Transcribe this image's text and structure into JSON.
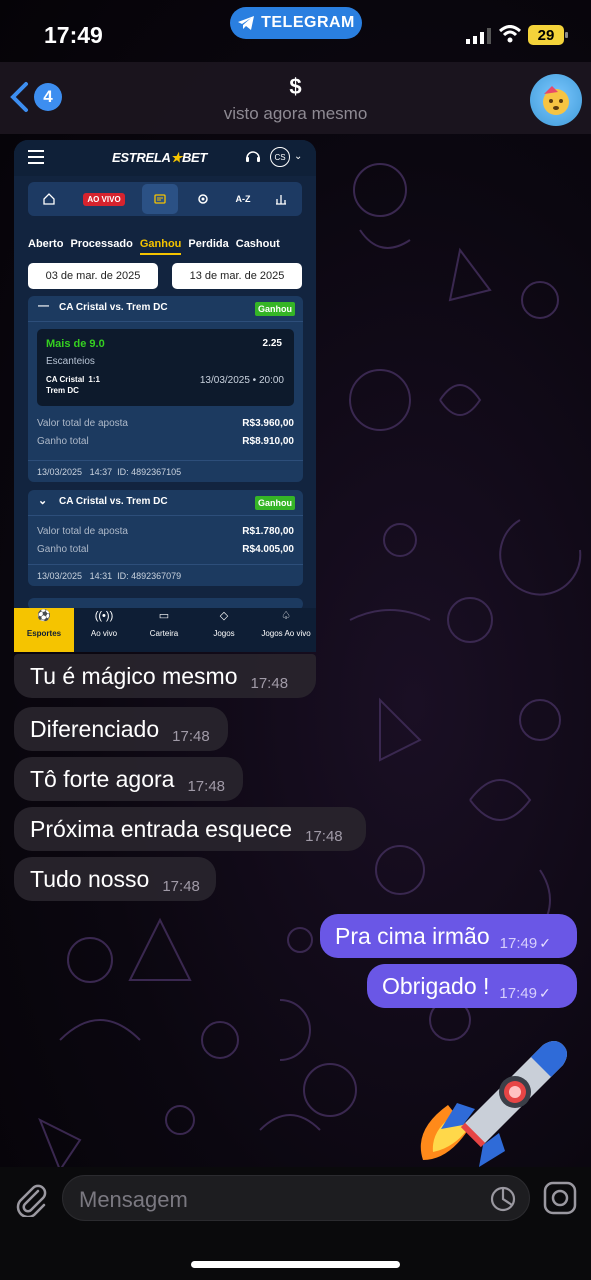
{
  "status_bar": {
    "time": "17:49",
    "app_pill": "TELEGRAM",
    "battery": "29"
  },
  "header": {
    "back_count": "4",
    "title": "$",
    "subtitle": "visto agora mesmo"
  },
  "screenshot": {
    "brand_left": "ESTRELA",
    "brand_right": "BET",
    "account": "CS",
    "nav": {
      "live": "AO VIVO",
      "az": "A-Z"
    },
    "tabs": [
      "Aberto",
      "Processado",
      "Ganhou",
      "Perdida",
      "Cashout"
    ],
    "active_tab": "Ganhou",
    "date_from": "03 de mar. de 2025",
    "date_to": "13 de mar. de 2025",
    "bets": [
      {
        "match": "CA Cristal vs. Trem DC",
        "status": "Ganhou",
        "pick": "Mais de 9.0",
        "odd": "2.25",
        "market": "Escanteios",
        "home": "CA Cristal",
        "score": "1:1",
        "away": "Trem DC",
        "kickoff": "13/03/2025 • 20:00",
        "stake_label": "Valor total de aposta",
        "stake": "R$3.960,00",
        "win_label": "Ganho total",
        "win": "R$8.910,00",
        "footer_date": "13/03/2025",
        "footer_time": "14:37",
        "footer_id": "ID: 4892367105"
      },
      {
        "match": "CA Cristal vs. Trem DC",
        "status": "Ganhou",
        "stake_label": "Valor total de aposta",
        "stake": "R$1.780,00",
        "win_label": "Ganho total",
        "win": "R$4.005,00",
        "footer_date": "13/03/2025",
        "footer_time": "14:31",
        "footer_id": "ID: 4892367079"
      }
    ],
    "bottom_nav": [
      "Esportes",
      "Ao vivo",
      "Carteira",
      "Jogos",
      "Jogos Ao vivo"
    ]
  },
  "messages": [
    {
      "text": "Tu é mágico mesmo",
      "time": "17:48",
      "dir": "in"
    },
    {
      "text": "Diferenciado",
      "time": "17:48",
      "dir": "in"
    },
    {
      "text": "Tô forte agora",
      "time": "17:48",
      "dir": "in"
    },
    {
      "text": "Próxima entrada esquece",
      "time": "17:48",
      "dir": "in"
    },
    {
      "text": "Tudo nosso",
      "time": "17:48",
      "dir": "in"
    },
    {
      "text": "Pra cima irmão",
      "time": "17:49",
      "dir": "out"
    },
    {
      "text": "Obrigado !",
      "time": "17:49",
      "dir": "out"
    }
  ],
  "composer": {
    "placeholder": "Mensagem"
  },
  "colors": {
    "outgoing": "#6a57e6",
    "incoming": "#28242c",
    "accent_yellow": "#f5c400",
    "won_green": "#35b526"
  },
  "icons": [
    "telegram-icon",
    "signal-icon",
    "wifi-icon",
    "battery-icon",
    "back-chevron-icon",
    "avatar-emoji-icon",
    "rocket-sticker",
    "attach-icon",
    "sticker-icon",
    "camera-icon"
  ]
}
